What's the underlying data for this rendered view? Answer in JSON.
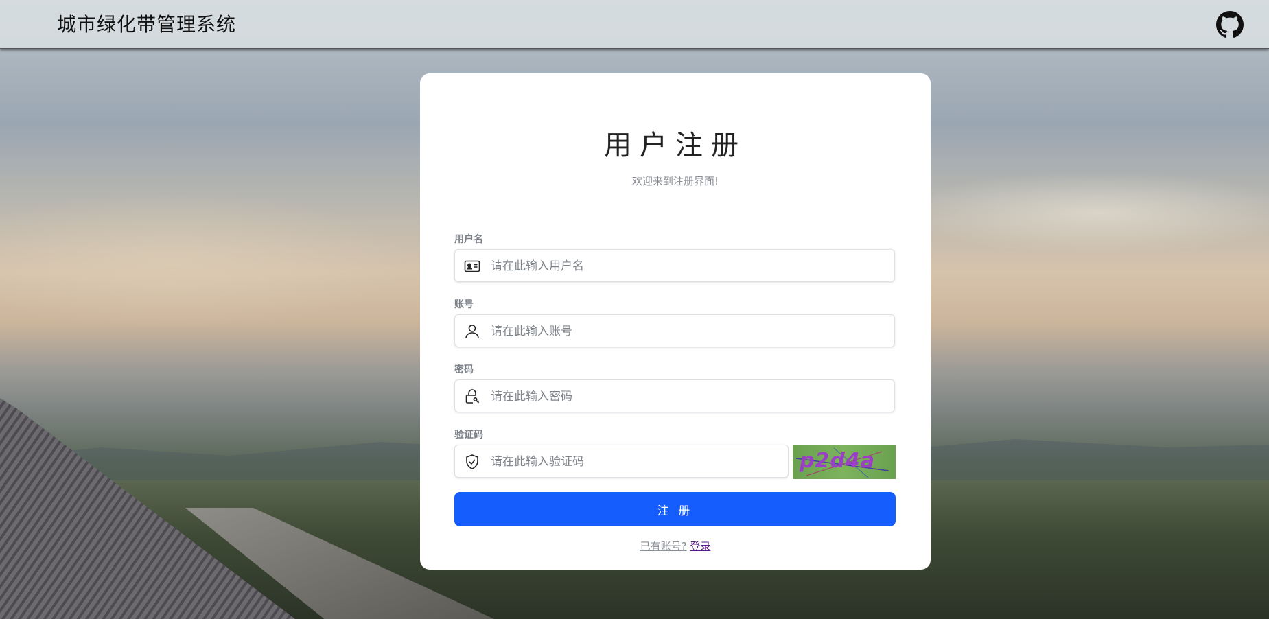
{
  "header": {
    "app_title": "城市绿化带管理系统",
    "github_icon": "github-icon"
  },
  "form": {
    "title": "用户注册",
    "subtitle": "欢迎来到注册界面!",
    "fields": [
      {
        "label": "用户名",
        "placeholder": "请在此输入用户名",
        "value": "",
        "icon": "id-card-icon"
      },
      {
        "label": "账号",
        "placeholder": "请在此输入账号",
        "value": "",
        "icon": "user-icon"
      },
      {
        "label": "密码",
        "placeholder": "请在此输入密码",
        "value": "",
        "icon": "lock-key-icon"
      },
      {
        "label": "验证码",
        "placeholder": "请在此输入验证码",
        "value": "",
        "icon": "shield-check-icon"
      }
    ],
    "captcha_text": "p2d4a",
    "submit_label": "注 册",
    "footer_question": "已有账号?",
    "footer_link": "登录"
  },
  "colors": {
    "primary": "#155dfc",
    "card_bg": "#ffffff",
    "captcha_bg": "#6aa14e",
    "captcha_text": "#9b3fc6"
  }
}
